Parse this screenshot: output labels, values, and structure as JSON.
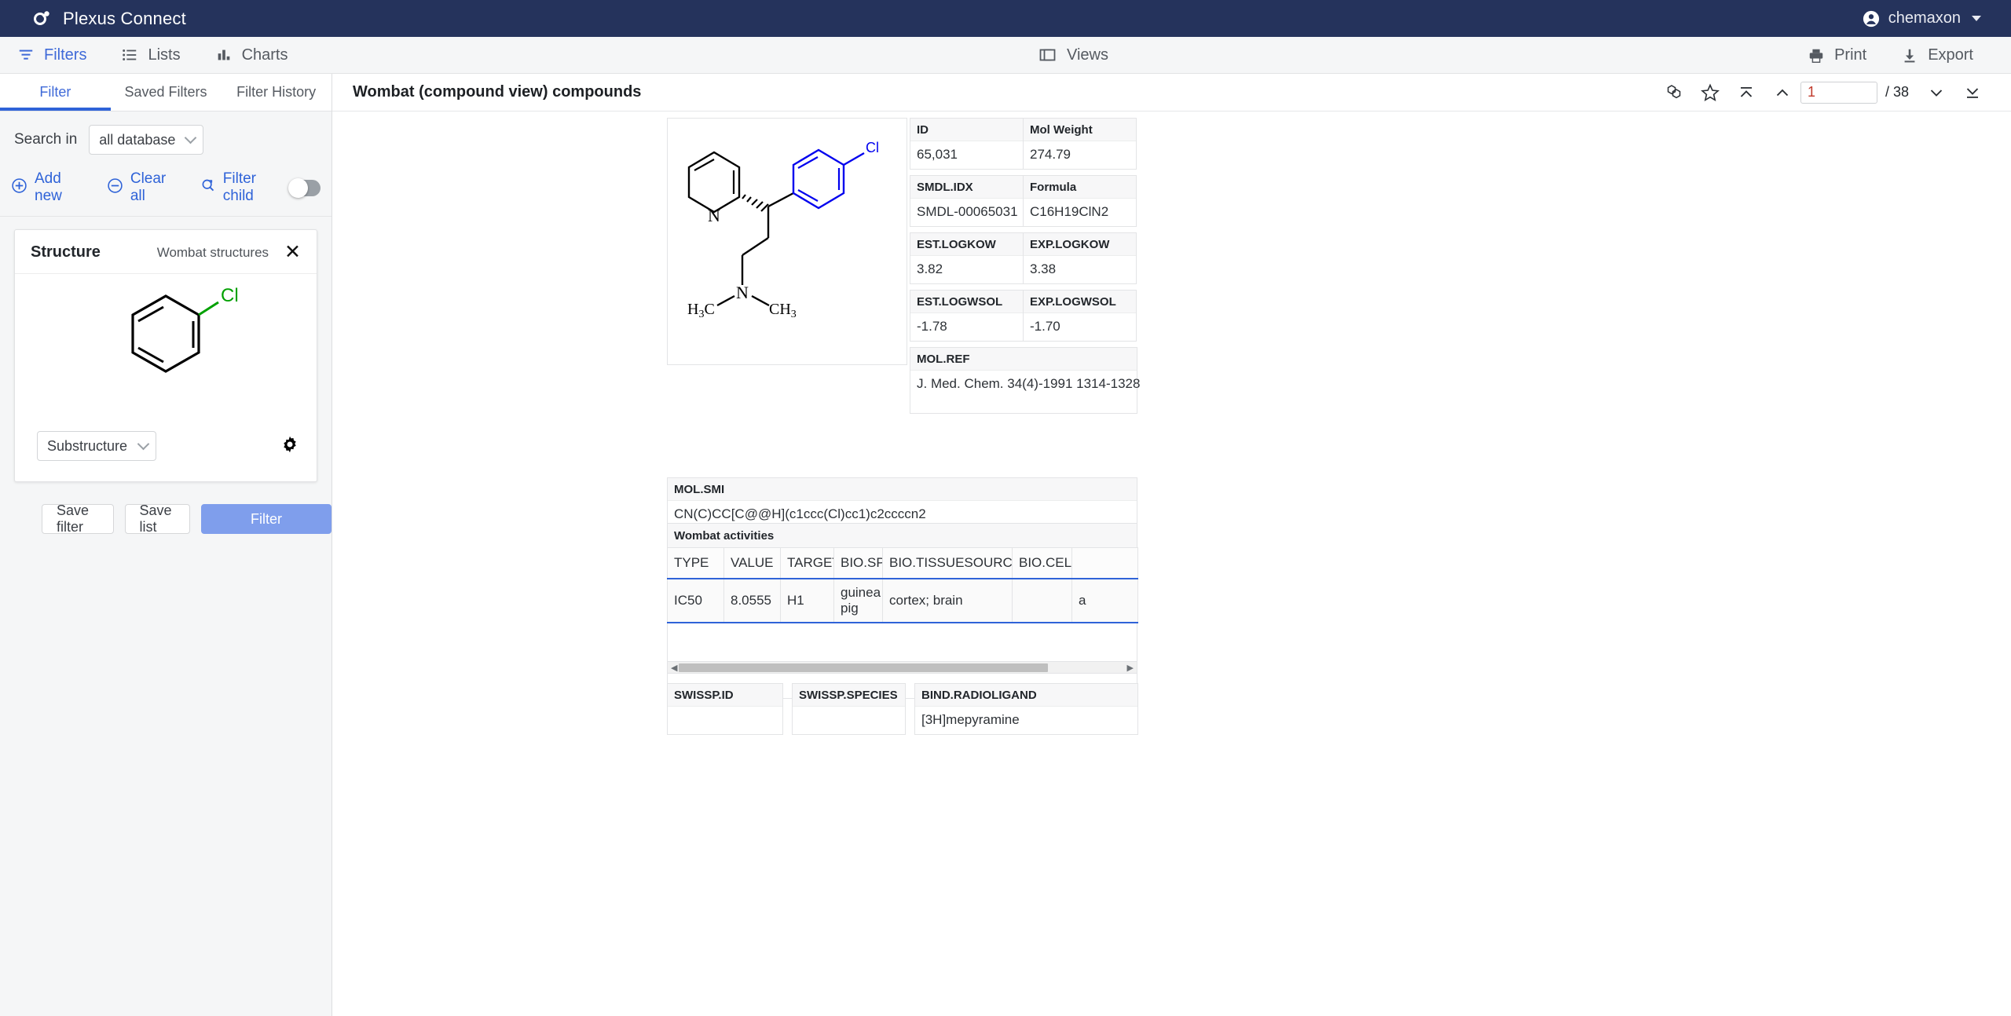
{
  "app": {
    "brand": "Plexus Connect",
    "logo_icon": "molecule-logo-icon",
    "user": "chemaxon",
    "user_icon": "account-circle-icon",
    "user_caret_icon": "chevron-down-icon",
    "accent_color": "#2f63d8",
    "topbar_color": "#25335c"
  },
  "toolbar": {
    "left_items": [
      {
        "label": "Filters",
        "icon": "filter-icon",
        "active": true
      },
      {
        "label": "Lists",
        "icon": "list-icon",
        "active": false
      },
      {
        "label": "Charts",
        "icon": "bar-chart-icon",
        "active": false
      }
    ],
    "center_item": {
      "label": "Views",
      "icon": "views-copy-icon"
    },
    "right_items": [
      {
        "label": "Print",
        "icon": "printer-icon"
      },
      {
        "label": "Export",
        "icon": "download-icon"
      }
    ]
  },
  "left_panel": {
    "tabs": [
      {
        "label": "Filter",
        "active": true
      },
      {
        "label": "Saved Filters",
        "active": false
      },
      {
        "label": "Filter History",
        "active": false
      }
    ],
    "search_in_label": "Search in",
    "search_in_value": "all database",
    "actions": [
      {
        "label": "Add new",
        "icon": "plus-circle-icon"
      },
      {
        "label": "Clear all",
        "icon": "minus-circle-icon"
      },
      {
        "label": "Filter child",
        "icon": "search-refresh-icon"
      }
    ],
    "filter_child_toggle": "off",
    "structure_card": {
      "title": "Structure",
      "subtitle": "Wombat structures",
      "close_icon": "close-icon",
      "search_mode": "Substructure",
      "settings_icon": "gear-icon",
      "sketch": {
        "ring": "benzene",
        "substituent_label": "Cl",
        "substituent_color": "#00a000"
      }
    },
    "buttons": {
      "save_filter": "Save filter",
      "save_list": "Save list",
      "filter": "Filter"
    }
  },
  "main": {
    "title": "Wombat (compound view) compounds",
    "pager": {
      "icons": [
        "molecule-cluster-icon",
        "star-icon",
        "first-page-icon",
        "previous-page-icon"
      ],
      "page_value": "1",
      "page_total": "/ 38",
      "next_icon": "next-page-icon",
      "last_icon": "last-page-icon"
    },
    "structure": {
      "name": "chlorpheniramine-structure",
      "labels": {
        "pyridine_n": "N",
        "cl": "Cl",
        "amine_n": "N",
        "methyl_left": "H3C",
        "methyl_right": "CH3"
      },
      "highlight_color": "#0000ee"
    },
    "fields": [
      {
        "label": "ID",
        "value": "65,031"
      },
      {
        "label": "Mol Weight",
        "value": "274.79"
      },
      {
        "label": "SMDL.IDX",
        "value": "SMDL-00065031"
      },
      {
        "label": "Formula",
        "value": "C16H19ClN2"
      },
      {
        "label": "EST.LOGKOW",
        "value": "3.82"
      },
      {
        "label": "EXP.LOGKOW",
        "value": "3.38"
      },
      {
        "label": "EST.LOGWSOL",
        "value": "-1.78"
      },
      {
        "label": "EXP.LOGWSOL",
        "value": "-1.70"
      }
    ],
    "mol_ref": {
      "label": "MOL.REF",
      "value": "J. Med. Chem. 34(4)-1991 1314-1328"
    },
    "mol_smi": {
      "label": "MOL.SMI",
      "value": "CN(C)CC[C@@H](c1ccc(Cl)cc1)c2ccccn2"
    },
    "activities": {
      "title": "Wombat activities",
      "columns": [
        "TYPE",
        "VALUE",
        "TARGET.NA",
        "BIO.SPECIE",
        "BIO.TISSUESOURCE",
        "BIO.CELL",
        ""
      ],
      "rows": [
        [
          "IC50",
          "8.0555",
          "H1",
          "guinea pig",
          "cortex; brain",
          "",
          "a"
        ]
      ],
      "scroll_left_icon": "scroll-left-arrow-icon",
      "scroll_right_icon": "scroll-right-arrow-icon"
    },
    "swiss_fields": [
      {
        "label": "SWISSP.ID",
        "value": ""
      },
      {
        "label": "SWISSP.SPECIES",
        "value": ""
      },
      {
        "label": "BIND.RADIOLIGAND",
        "value": "[3H]mepyramine"
      }
    ]
  }
}
